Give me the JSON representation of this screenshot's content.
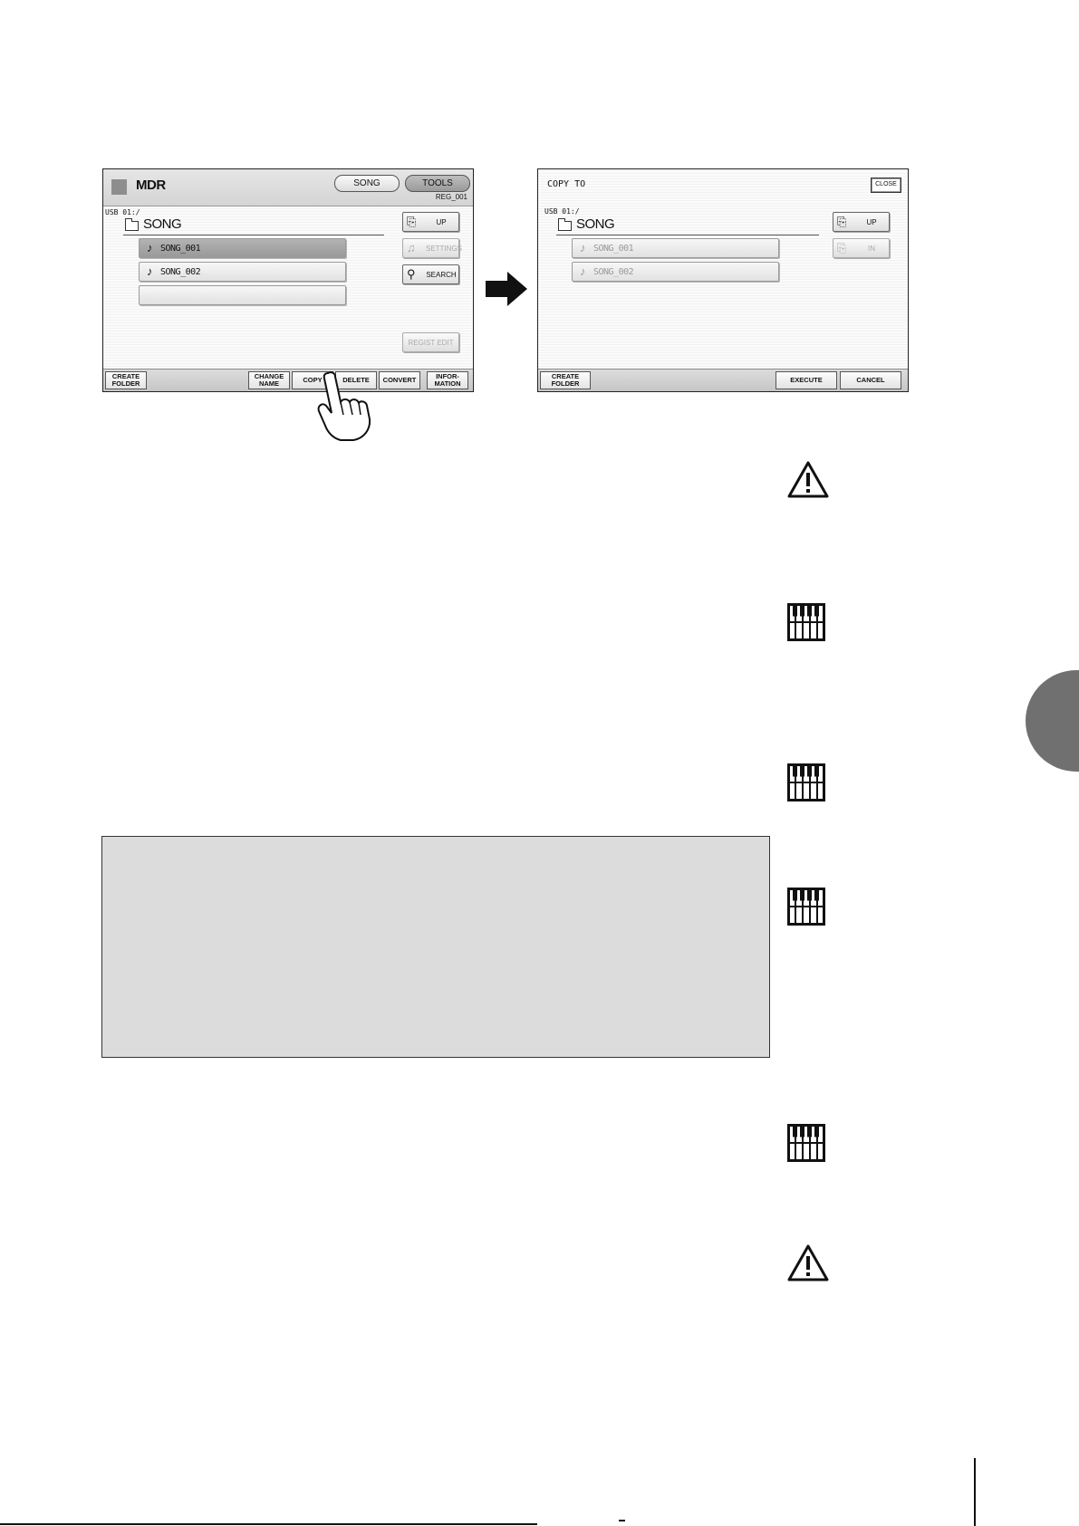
{
  "screen1": {
    "title": "MDR",
    "tabs": [
      "SONG",
      "TOOLS"
    ],
    "reg_label": "REG_001",
    "path": "USB 01:/",
    "folder": "SONG",
    "files": [
      "SONG_001",
      "SONG_002"
    ],
    "side_buttons": {
      "up": "UP",
      "settings": "SETTINGS",
      "search": "SEARCH",
      "regist_edit": "REGIST EDIT"
    },
    "bottom": {
      "create_folder": "CREATE\nFOLDER",
      "change_name": "CHANGE\nNAME",
      "copy": "COPY",
      "delete": "DELETE",
      "convert": "CONVERT",
      "information": "INFOR-\nMATION"
    }
  },
  "screen2": {
    "title": "COPY TO",
    "close": "CLOSE",
    "path": "USB 01:/",
    "folder": "SONG",
    "files": [
      "SONG_001",
      "SONG_002"
    ],
    "side_buttons": {
      "up": "UP",
      "in": "IN"
    },
    "bottom": {
      "create_folder": "CREATE\nFOLDER",
      "execute": "EXECUTE",
      "cancel": "CANCEL"
    }
  },
  "icons": {
    "arrow": "right-arrow-icon",
    "hand": "pointing-hand-icon",
    "caution": "caution-triangle-icon",
    "keyboard": "keyboard-icon"
  }
}
